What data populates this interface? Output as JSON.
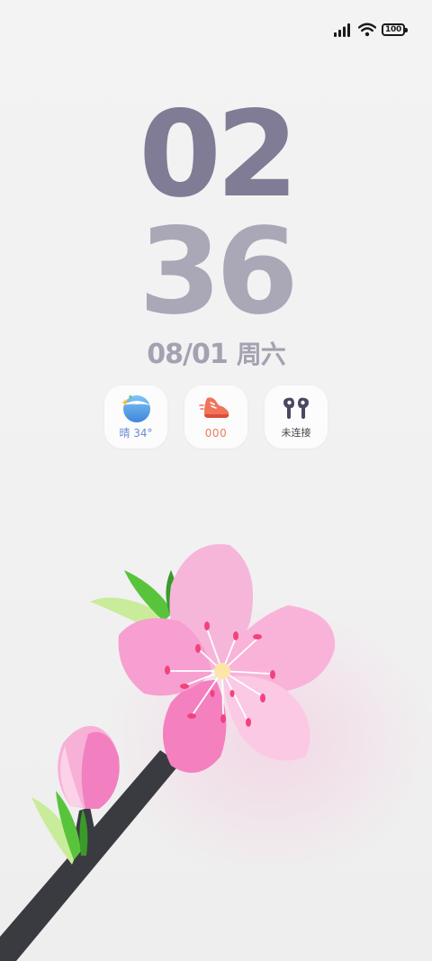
{
  "status_bar": {
    "signal_icon": "cellular-signal-icon",
    "wifi_icon": "wifi-icon",
    "battery_level": "100"
  },
  "clock": {
    "hour": "02",
    "minute": "36"
  },
  "date": {
    "date": "08/01",
    "weekday": "周六"
  },
  "widgets": {
    "weather": {
      "icon": "weather-moon-icon",
      "label": "晴 34°"
    },
    "steps": {
      "icon": "running-shoe-icon",
      "label": "000"
    },
    "earbuds": {
      "icon": "earbuds-icon",
      "label": "未连接"
    }
  },
  "colors": {
    "hour": "#807c95",
    "minute": "#aaa7b6",
    "date": "#a4a1b1",
    "weather_label": "#6b88d8",
    "steps_label": "#f07a5e",
    "blossom_pink": "#f9a8d2",
    "branch": "#3a3b40"
  },
  "wallpaper": {
    "subject": "peach-blossom-branch"
  }
}
